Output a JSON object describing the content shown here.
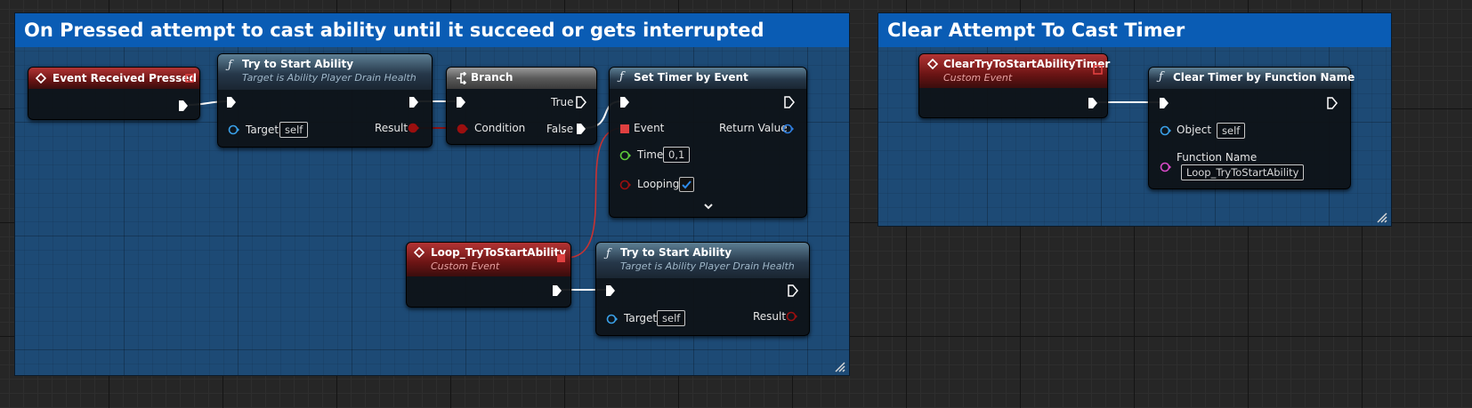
{
  "comments": {
    "left": {
      "title": "On Pressed attempt to cast ability until it succeed or gets interrupted"
    },
    "right": {
      "title": "Clear Attempt To Cast Timer"
    }
  },
  "nodes": {
    "event_pressed": {
      "title": "Event Received Pressed"
    },
    "try_start_1": {
      "title": "Try to Start Ability",
      "subtitle": "Target is Ability Player Drain Health",
      "target_label": "Target",
      "target_value": "self",
      "result_label": "Result"
    },
    "branch": {
      "title": "Branch",
      "true_label": "True",
      "false_label": "False",
      "condition_label": "Condition"
    },
    "set_timer": {
      "title": "Set Timer by Event",
      "event_label": "Event",
      "return_label": "Return Value",
      "time_label": "Time",
      "time_value": "0,1",
      "looping_label": "Looping",
      "looping_checked": true
    },
    "loop_event": {
      "title": "Loop_TryToStartAbility",
      "subtitle": "Custom Event"
    },
    "try_start_2": {
      "title": "Try to Start Ability",
      "subtitle": "Target is Ability Player Drain Health",
      "target_label": "Target",
      "target_value": "self",
      "result_label": "Result"
    },
    "clear_event": {
      "title": "ClearTryToStartAbilityTimer",
      "subtitle": "Custom Event"
    },
    "clear_timer": {
      "title": "Clear Timer by Function Name",
      "object_label": "Object",
      "object_value": "self",
      "function_label": "Function Name",
      "function_value": "Loop_TryToStartAbility"
    }
  },
  "colors": {
    "comment_header": "#0a5cb4",
    "comment_body": "#1d4a75",
    "exec_pin": "#ffffff",
    "object_pin": "#3aa0e8",
    "bool_pin": "#9b0f0f",
    "float_pin": "#5ecb3a",
    "name_pin": "#d94ac8",
    "delegate_pin": "#e04040",
    "delegate_wire": "#d23a3a"
  },
  "icons": {
    "event": "event-diamond-icon",
    "function": "function-f-icon",
    "branch": "branch-icon",
    "expand": "chevron-down-icon",
    "resize": "resize-grip-icon"
  }
}
